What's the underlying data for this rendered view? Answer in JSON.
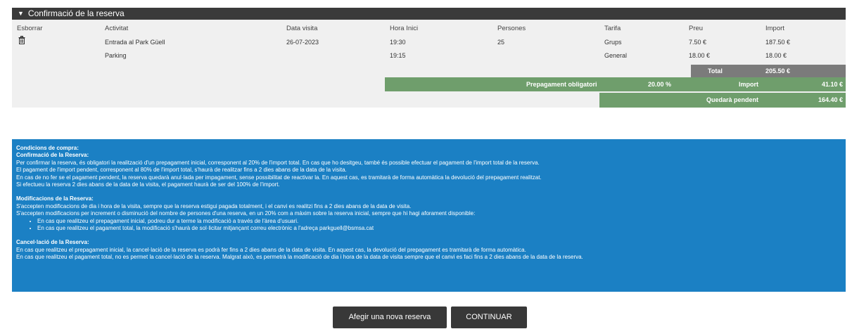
{
  "panel": {
    "title": "Confirmació de la reserva"
  },
  "table": {
    "headers": {
      "delete": "Esborrar",
      "activity": "Activitat",
      "date": "Data visita",
      "time": "Hora Inici",
      "people": "Persones",
      "tariff": "Tarifa",
      "price": "Preu",
      "amount": "Import"
    },
    "rows": [
      {
        "activity": "Entrada al Park Güell",
        "date": "26-07-2023",
        "time": "19:30",
        "people": "25",
        "tariff": "Grups",
        "price": "7.50 €",
        "amount": "187.50 €"
      },
      {
        "activity": "Parking",
        "date": "",
        "time": "19:15",
        "people": "",
        "tariff": "General",
        "price": "18.00 €",
        "amount": "18.00 €"
      }
    ]
  },
  "summary": {
    "total_label": "Total",
    "total_value": "205.50 €",
    "prepayment_label": "Prepagament obligatori",
    "prepayment_percent": "20.00 %",
    "import_label": "Import",
    "import_value": "41.10 €",
    "pending_label": "Quedarà pendent",
    "pending_value": "164.40 €"
  },
  "conditions": {
    "title": "Condicions de compra:",
    "confirmation": {
      "heading": "Confirmació de la Reserva:",
      "lines": [
        "Per confirmar la reserva, és obligatori la realització d'un prepagament inicial, corresponent al 20% de l'import total. En cas que ho desitgeu, també és possible efectuar el pagament de l'import total de la reserva.",
        "El pagament de l'import pendent, corresponent al 80% de l'import total, s'haurà de realitzar fins a 2 dies abans de la data de la visita.",
        "En cas de no fer se el pagament pendent, la reserva quedarà anul·lada per impagament, sense possibilitat de reactivar la. En aquest cas, es tramitarà de forma automàtica la devolució del prepagament realitzat.",
        "Si efectueu la reserva 2 dies abans de la data de la visita, el pagament haurà de ser del 100% de l'import."
      ]
    },
    "modifications": {
      "heading": "Modificacions de la Reserva:",
      "lines": [
        "S'accepten modificacions de dia i hora de la visita, sempre que la reserva estigui pagada totalment, i el canvi es realitzi fins a 2 dies abans de la data de visita.",
        "S'accepten modificacions per increment o disminució del nombre de persones d'una reserva, en un 20% com a màxim sobre la reserva inicial, sempre que hi hagi aforament disponible:"
      ],
      "bullets": [
        "En cas que realitzeu el prepagament inicial, podreu dur a terme la modificació a través de l'àrea d'usuari.",
        "En cas que realitzeu el pagament total, la modificació s'haurà de sol·licitar mitjançant correu electrònic a l'adreça parkguell@bsmsa.cat"
      ]
    },
    "cancellation": {
      "heading": "Cancel·lació de la Reserva:",
      "lines": [
        "En cas que realitzeu el prepagament inicial, la cancel·lació de la reserva es podrà fer fins a 2 dies abans de la data de visita. En aquest cas, la devolució del prepagament es tramitarà de forma automàtica.",
        "En cas que realitzeu el pagament total, no es permet la cancel·lació de la reserva. Malgrat això, es permetrà la modificació de dia i hora de la data de visita sempre que el canvi es faci fins a 2 dies abans de la data de la reserva."
      ]
    }
  },
  "buttons": {
    "add_reservation": "Afegir una nova reserva",
    "continue": "CONTINUAR"
  }
}
